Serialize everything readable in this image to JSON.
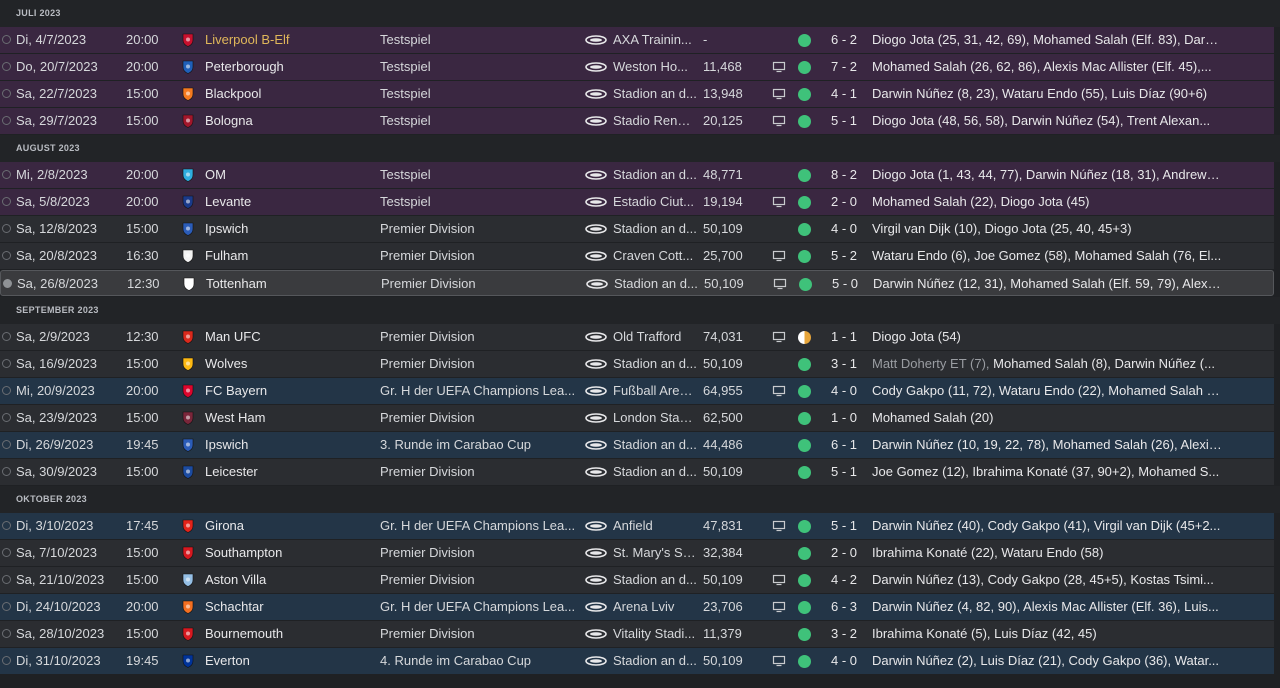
{
  "colors": {
    "win": "#3fc27a",
    "draw": "#e7a53a",
    "favourite_team_text": "#e0b75a"
  },
  "months": [
    {
      "label": "JULI 2023",
      "matches": [
        {
          "type": "friendly",
          "done": false,
          "date": "Di, 4/7/2023",
          "time": "20:00",
          "crest": {
            "icon": "liverpool-crest-icon",
            "color": "#c8102e"
          },
          "opponent": "Liverpool B-Elf",
          "highlight": true,
          "competition": "Testspiel",
          "venue": "AXA Trainin...",
          "attendance": "-",
          "tv": false,
          "result": "win",
          "score": "6 - 2",
          "scorers": "Diogo Jota (25, 31, 42, 69), Mohamed Salah (Elf. 83), Darwi..."
        },
        {
          "type": "friendly",
          "done": false,
          "date": "Do, 20/7/2023",
          "time": "20:00",
          "crest": {
            "icon": "peterborough-crest-icon",
            "color": "#1f5fb8"
          },
          "opponent": "Peterborough",
          "competition": "Testspiel",
          "venue": "Weston Ho...",
          "attendance": "11,468",
          "tv": true,
          "result": "win",
          "score": "7 - 2",
          "scorers": "Mohamed Salah (26, 62, 86), Alexis Mac Allister (Elf. 45),..."
        },
        {
          "type": "friendly",
          "done": false,
          "date": "Sa, 22/7/2023",
          "time": "15:00",
          "crest": {
            "icon": "blackpool-crest-icon",
            "color": "#f47a20"
          },
          "opponent": "Blackpool",
          "competition": "Testspiel",
          "venue": "Stadion an d...",
          "attendance": "13,948",
          "tv": true,
          "result": "win",
          "score": "4 - 1",
          "scorers": "Darwin Núñez (8, 23), Wataru Endo (55), Luis Díaz (90+6)"
        },
        {
          "type": "friendly",
          "done": false,
          "date": "Sa, 29/7/2023",
          "time": "15:00",
          "crest": {
            "icon": "bologna-crest-icon",
            "color": "#a2162b"
          },
          "opponent": "Bologna",
          "competition": "Testspiel",
          "venue": "Stadio Renat...",
          "attendance": "20,125",
          "tv": true,
          "result": "win",
          "score": "5 - 1",
          "scorers": "Diogo Jota (48, 56, 58), Darwin Núñez (54), Trent Alexan..."
        }
      ]
    },
    {
      "label": "AUGUST 2023",
      "matches": [
        {
          "type": "friendly",
          "done": false,
          "date": "Mi, 2/8/2023",
          "time": "20:00",
          "crest": {
            "icon": "om-crest-icon",
            "color": "#2faee0"
          },
          "opponent": "OM",
          "competition": "Testspiel",
          "venue": "Stadion an d...",
          "attendance": "48,771",
          "tv": false,
          "result": "win",
          "score": "8 - 2",
          "scorers": "Diogo Jota (1, 43, 44, 77), Darwin Núñez (18, 31), Andrew R..."
        },
        {
          "type": "friendly",
          "done": false,
          "date": "Sa, 5/8/2023",
          "time": "20:00",
          "crest": {
            "icon": "levante-crest-icon",
            "color": "#1a3a8a"
          },
          "opponent": "Levante",
          "competition": "Testspiel",
          "venue": "Estadio Ciut...",
          "attendance": "19,194",
          "tv": true,
          "result": "win",
          "score": "2 - 0",
          "scorers": "Mohamed Salah (22), Diogo Jota (45)"
        },
        {
          "type": "league",
          "done": false,
          "date": "Sa, 12/8/2023",
          "time": "15:00",
          "crest": {
            "icon": "ipswich-crest-icon",
            "color": "#2b5cb8"
          },
          "opponent": "Ipswich",
          "competition": "Premier Division",
          "venue": "Stadion an d...",
          "attendance": "50,109",
          "tv": false,
          "result": "win",
          "score": "4 - 0",
          "scorers": "Virgil van Dijk (10), Diogo Jota (25, 40, 45+3)"
        },
        {
          "type": "league",
          "done": false,
          "date": "Sa, 20/8/2023",
          "time": "16:30",
          "crest": {
            "icon": "fulham-crest-icon",
            "color": "#f2f2f2"
          },
          "opponent": "Fulham",
          "competition": "Premier Division",
          "venue": "Craven Cott...",
          "attendance": "25,700",
          "tv": true,
          "result": "win",
          "score": "5 - 2",
          "scorers": "Wataru Endo (6), Joe Gomez (58), Mohamed Salah (76, El..."
        },
        {
          "type": "league",
          "done": true,
          "selected": true,
          "date": "Sa, 26/8/2023",
          "time": "12:30",
          "crest": {
            "icon": "tottenham-crest-icon",
            "color": "#ffffff"
          },
          "opponent": "Tottenham",
          "competition": "Premier Division",
          "venue": "Stadion an d...",
          "attendance": "50,109",
          "tv": true,
          "result": "win",
          "score": "5 - 0",
          "scorers": "Darwin Núñez (12, 31), Mohamed Salah (Elf. 59, 79), Alexis..."
        }
      ]
    },
    {
      "label": "SEPTEMBER 2023",
      "matches": [
        {
          "type": "league",
          "done": false,
          "date": "Sa, 2/9/2023",
          "time": "12:30",
          "crest": {
            "icon": "man-ufc-crest-icon",
            "color": "#da291c"
          },
          "opponent": "Man UFC",
          "competition": "Premier Division",
          "venue": "Old Trafford",
          "attendance": "74,031",
          "tv": true,
          "result": "draw",
          "score": "1 - 1",
          "scorers": "Diogo Jota (54)"
        },
        {
          "type": "league",
          "done": false,
          "date": "Sa, 16/9/2023",
          "time": "15:00",
          "crest": {
            "icon": "wolves-crest-icon",
            "color": "#fdb913"
          },
          "opponent": "Wolves",
          "competition": "Premier Division",
          "venue": "Stadion an d...",
          "attendance": "50,109",
          "tv": false,
          "result": "win",
          "score": "3 - 1",
          "scorers_muted": "Matt Doherty ET (7),",
          "scorers": "Mohamed Salah (8), Darwin Núñez (..."
        },
        {
          "type": "europe",
          "done": false,
          "date": "Mi, 20/9/2023",
          "time": "20:00",
          "crest": {
            "icon": "fc-bayern-crest-icon",
            "color": "#dc052d"
          },
          "opponent": "FC Bayern",
          "competition": "Gr. H der UEFA Champions Lea...",
          "venue": "Fußball Aren...",
          "attendance": "64,955",
          "tv": true,
          "result": "win",
          "score": "4 - 0",
          "scorers": "Cody Gakpo (11, 72), Wataru Endo (22), Mohamed Salah (E..."
        },
        {
          "type": "league",
          "done": false,
          "date": "Sa, 23/9/2023",
          "time": "15:00",
          "crest": {
            "icon": "west-ham-crest-icon",
            "color": "#7a263a"
          },
          "opponent": "West Ham",
          "competition": "Premier Division",
          "venue": "London Stad...",
          "attendance": "62,500",
          "tv": false,
          "result": "win",
          "score": "1 - 0",
          "scorers": "Mohamed Salah (20)"
        },
        {
          "type": "europe",
          "done": false,
          "date": "Di, 26/9/2023",
          "time": "19:45",
          "crest": {
            "icon": "ipswich-crest-icon",
            "color": "#2b5cb8"
          },
          "opponent": "Ipswich",
          "competition": "3. Runde im Carabao Cup",
          "venue": "Stadion an d...",
          "attendance": "44,486",
          "tv": false,
          "result": "win",
          "score": "6 - 1",
          "scorers": "Darwin Núñez (10, 19, 22, 78), Mohamed Salah (26), Alexis..."
        },
        {
          "type": "league",
          "done": false,
          "date": "Sa, 30/9/2023",
          "time": "15:00",
          "crest": {
            "icon": "leicester-crest-icon",
            "color": "#1c4ba0"
          },
          "opponent": "Leicester",
          "competition": "Premier Division",
          "venue": "Stadion an d...",
          "attendance": "50,109",
          "tv": false,
          "result": "win",
          "score": "5 - 1",
          "scorers": "Joe Gomez (12), Ibrahima Konaté (37, 90+2), Mohamed S..."
        }
      ]
    },
    {
      "label": "OKTOBER 2023",
      "matches": [
        {
          "type": "europe",
          "done": false,
          "date": "Di, 3/10/2023",
          "time": "17:45",
          "crest": {
            "icon": "girona-crest-icon",
            "color": "#e2231a"
          },
          "opponent": "Girona",
          "competition": "Gr. H der UEFA Champions Lea...",
          "venue": "Anfield",
          "attendance": "47,831",
          "tv": true,
          "result": "win",
          "score": "5 - 1",
          "scorers": "Darwin Núñez (40), Cody Gakpo (41), Virgil van Dijk (45+2..."
        },
        {
          "type": "league",
          "done": false,
          "date": "Sa, 7/10/2023",
          "time": "15:00",
          "crest": {
            "icon": "southampton-crest-icon",
            "color": "#d71920"
          },
          "opponent": "Southampton",
          "competition": "Premier Division",
          "venue": "St. Mary's St...",
          "attendance": "32,384",
          "tv": false,
          "result": "win",
          "score": "2 - 0",
          "scorers": "Ibrahima Konaté (22), Wataru Endo (58)"
        },
        {
          "type": "league",
          "done": false,
          "date": "Sa, 21/10/2023",
          "time": "15:00",
          "crest": {
            "icon": "aston-villa-crest-icon",
            "color": "#95bfe5"
          },
          "opponent": "Aston Villa",
          "competition": "Premier Division",
          "venue": "Stadion an d...",
          "attendance": "50,109",
          "tv": true,
          "result": "win",
          "score": "4 - 2",
          "scorers": "Darwin Núñez (13), Cody Gakpo (28, 45+5), Kostas Tsimi..."
        },
        {
          "type": "europe",
          "done": false,
          "date": "Di, 24/10/2023",
          "time": "20:00",
          "crest": {
            "icon": "schachtar-crest-icon",
            "color": "#f36f21"
          },
          "opponent": "Schachtar",
          "competition": "Gr. H der UEFA Champions Lea...",
          "venue": "Arena Lviv",
          "attendance": "23,706",
          "tv": true,
          "result": "win",
          "score": "6 - 3",
          "scorers": "Darwin Núñez (4, 82, 90), Alexis Mac Allister (Elf. 36), Luis..."
        },
        {
          "type": "league",
          "done": false,
          "date": "Sa, 28/10/2023",
          "time": "15:00",
          "crest": {
            "icon": "bournemouth-crest-icon",
            "color": "#d71920"
          },
          "opponent": "Bournemouth",
          "competition": "Premier Division",
          "venue": "Vitality Stadi...",
          "attendance": "11,379",
          "tv": false,
          "result": "win",
          "score": "3 - 2",
          "scorers": "Ibrahima Konaté (5), Luis Díaz (42, 45)"
        },
        {
          "type": "europe",
          "done": false,
          "date": "Di, 31/10/2023",
          "time": "19:45",
          "crest": {
            "icon": "everton-crest-icon",
            "color": "#003399"
          },
          "opponent": "Everton",
          "competition": "4. Runde im Carabao Cup",
          "venue": "Stadion an d...",
          "attendance": "50,109",
          "tv": true,
          "result": "win",
          "score": "4 - 0",
          "scorers": "Darwin Núñez (2), Luis Díaz (21), Cody Gakpo (36), Watar..."
        }
      ]
    }
  ]
}
